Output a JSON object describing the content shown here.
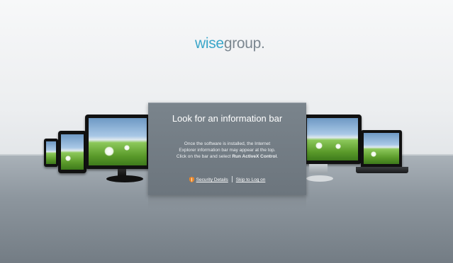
{
  "brand": {
    "wise": "wise",
    "group": "group",
    "dot": "."
  },
  "panel": {
    "title": "Look for an information bar",
    "body_line1": "Once the software is installed, the Internet",
    "body_line2": "Explorer information bar may appear at the top.",
    "body_line3_prefix": "Click on the bar and select ",
    "body_line3_bold": "Run ActiveX Control",
    "body_line3_suffix": "."
  },
  "links": {
    "security_details": "Security Details",
    "skip_to_log_on": "Skip to Log on"
  },
  "icons": {
    "shield": "shield-icon"
  },
  "colors": {
    "brand_accent": "#3aa6c9",
    "brand_gray": "#7b8790",
    "panel": "#737c84",
    "shield": "#e8872a"
  }
}
